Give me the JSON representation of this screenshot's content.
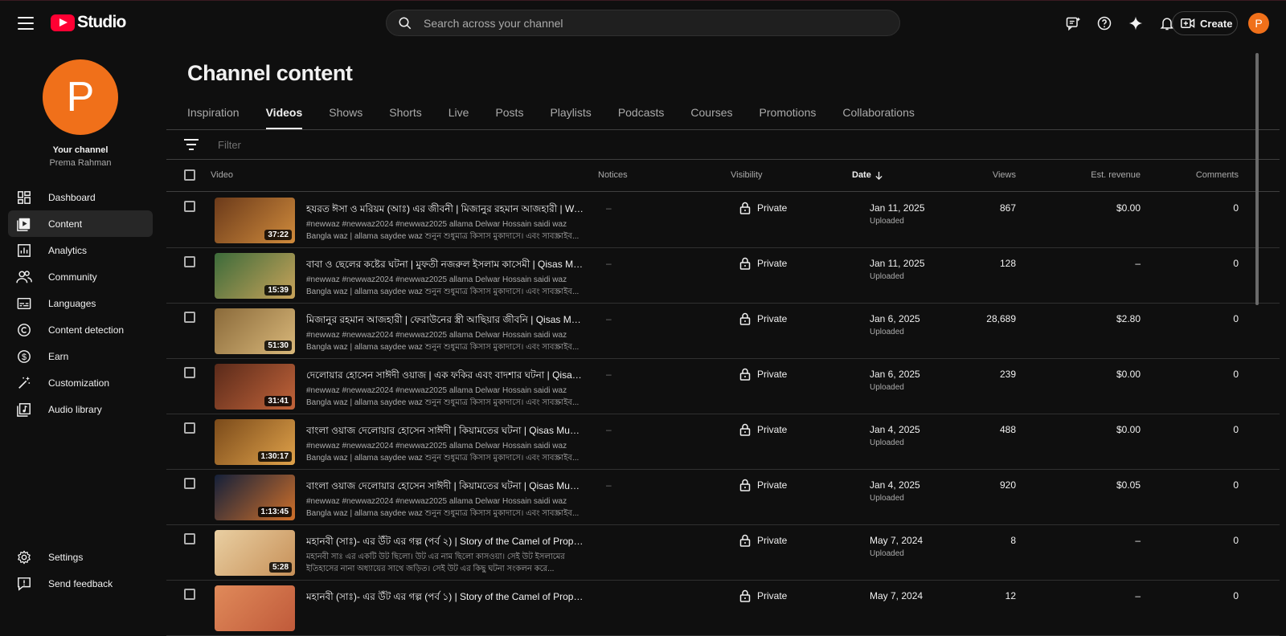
{
  "app": {
    "studio_label": "Studio"
  },
  "search": {
    "placeholder": "Search across your channel"
  },
  "header": {
    "create_label": "Create",
    "avatar_letter": "P"
  },
  "channel": {
    "avatar_letter": "P",
    "your_channel": "Your channel",
    "name": "Prema Rahman"
  },
  "sidebar": {
    "items": [
      {
        "label": "Dashboard",
        "icon": "dashboard-icon"
      },
      {
        "label": "Content",
        "icon": "content-icon",
        "active": true
      },
      {
        "label": "Analytics",
        "icon": "analytics-icon"
      },
      {
        "label": "Community",
        "icon": "community-icon"
      },
      {
        "label": "Languages",
        "icon": "languages-icon"
      },
      {
        "label": "Content detection",
        "icon": "copyright-icon"
      },
      {
        "label": "Earn",
        "icon": "dollar-icon"
      },
      {
        "label": "Customization",
        "icon": "magic-wand-icon"
      },
      {
        "label": "Audio library",
        "icon": "audio-library-icon"
      }
    ],
    "bottom": [
      {
        "label": "Settings",
        "icon": "gear-icon"
      },
      {
        "label": "Send feedback",
        "icon": "feedback-icon"
      }
    ]
  },
  "page": {
    "title": "Channel content",
    "tabs": [
      "Inspiration",
      "Videos",
      "Shows",
      "Shorts",
      "Live",
      "Posts",
      "Playlists",
      "Podcasts",
      "Courses",
      "Promotions",
      "Collaborations"
    ],
    "active_tab": "Videos",
    "filter_placeholder": "Filter"
  },
  "table": {
    "headers": {
      "video": "Video",
      "notices": "Notices",
      "visibility": "Visibility",
      "date": "Date",
      "views": "Views",
      "revenue": "Est. revenue",
      "comments": "Comments"
    },
    "rows": [
      {
        "title": "হযরত ঈসা ও মরিয়ম (আঃ) এর জীবনী | মিজানুর রহমান আজহারী | Wa...",
        "desc1": "#newwaz #newwaz2024 #newwaz2025 allama Delwar Hossain saidi waz",
        "desc2": "Bangla waz | allama saydee waz শুনুন শুধুমাত্র কিসাস মুকাদাসে। এবং সাবস্ক্রাইব...",
        "duration": "37:22",
        "notice": "–",
        "visibility": "Private",
        "date": "Jan 11, 2025",
        "date_sub": "Uploaded",
        "views": "867",
        "revenue": "$0.00",
        "comments": "0",
        "thumb": [
          "#6b3a1a",
          "#d08b3c"
        ]
      },
      {
        "title": "বাবা ও ছেলের কষ্টের ঘটনা | মুফতী নজরুল ইসলাম কাসেমী | Qisas Mu...",
        "desc1": "#newwaz #newwaz2024 #newwaz2025 allama Delwar Hossain saidi waz",
        "desc2": "Bangla waz | allama saydee waz শুনুন শুধুমাত্র কিসাস মুকাদাসে। এবং সাবস্ক্রাইব...",
        "duration": "15:39",
        "notice": "–",
        "visibility": "Private",
        "date": "Jan 11, 2025",
        "date_sub": "Uploaded",
        "views": "128",
        "revenue": "–",
        "comments": "0",
        "thumb": [
          "#3c6b3a",
          "#c9a35a"
        ]
      },
      {
        "title": "মিজানুর রহমান আজহারী | ফেরাউনের স্ত্রী আছিয়ার জীবনি | Qisas Mu...",
        "desc1": "#newwaz #newwaz2024 #newwaz2025 allama Delwar Hossain saidi waz",
        "desc2": "Bangla waz | allama saydee waz শুনুন শুধুমাত্র কিসাস মুকাদাসে। এবং সাবস্ক্রাইব...",
        "duration": "51:30",
        "notice": "–",
        "visibility": "Private",
        "date": "Jan 6, 2025",
        "date_sub": "Uploaded",
        "views": "28,689",
        "revenue": "$2.80",
        "comments": "0",
        "thumb": [
          "#8a6a3a",
          "#d9b87a"
        ]
      },
      {
        "title": "দেলোয়ার হোসেন সাঈদী ওয়াজ | এক ফকির এবং বাদশার ঘটনা | Qisas ...",
        "desc1": "#newwaz #newwaz2024 #newwaz2025 allama Delwar Hossain saidi waz",
        "desc2": "Bangla waz | allama saydee waz শুনুন শুধুমাত্র কিসাস মুকাদাসে। এবং সাবস্ক্রাইব...",
        "duration": "31:41",
        "notice": "–",
        "visibility": "Private",
        "date": "Jan 6, 2025",
        "date_sub": "Uploaded",
        "views": "239",
        "revenue": "$0.00",
        "comments": "0",
        "thumb": [
          "#5a2a1a",
          "#c2643a"
        ]
      },
      {
        "title": "বাংলা ওয়াজ দেলোয়ার হোসেন সাঈদী | কিয়ামতের ঘটনা | Qisas Muqa...",
        "desc1": "#newwaz #newwaz2024 #newwaz2025 allama Delwar Hossain saidi waz",
        "desc2": "Bangla waz | allama saydee waz শুনুন শুধুমাত্র কিসাস মুকাদাসে। এবং সাবস্ক্রাইব...",
        "duration": "1:30:17",
        "notice": "–",
        "visibility": "Private",
        "date": "Jan 4, 2025",
        "date_sub": "Uploaded",
        "views": "488",
        "revenue": "$0.00",
        "comments": "0",
        "thumb": [
          "#7a4a1a",
          "#e0a24a"
        ]
      },
      {
        "title": "বাংলা ওয়াজ দেলোয়ার হোসেন সাঈদী | কিয়ামতের ঘটনা | Qisas Muqa...",
        "desc1": "#newwaz #newwaz2024 #newwaz2025 allama Delwar Hossain saidi waz",
        "desc2": "Bangla waz | allama saydee waz শুনুন শুধুমাত্র কিসাস মুকাদাসে। এবং সাবস্ক্রাইব...",
        "duration": "1:13:45",
        "notice": "–",
        "visibility": "Private",
        "date": "Jan 4, 2025",
        "date_sub": "Uploaded",
        "views": "920",
        "revenue": "$0.05",
        "comments": "0",
        "thumb": [
          "#14203a",
          "#d0702a"
        ]
      },
      {
        "title": "মহানবী (সাঃ)- এর উঁট এর গল্প (পর্ব ২) | Story of the Camel of Prophet ...",
        "desc1": "মহানবী সাঃ এর একটি উট ছিলো। উট এর নাম ছিলো কাসওয়া। সেই উট ইসলামের",
        "desc2": "ইতিহাসের নানা অধ্যায়ের সাথে জড়িত। সেই উট এর কিছু ঘটনা সংকলন করে...",
        "duration": "5:28",
        "notice": "",
        "visibility": "Private",
        "date": "May 7, 2024",
        "date_sub": "Uploaded",
        "views": "8",
        "revenue": "–",
        "comments": "0",
        "thumb": [
          "#e9cfa2",
          "#c79058"
        ]
      },
      {
        "title": "মহানবী (সাঃ)- এর উঁট এর গল্প (পর্ব ১) | Story of the Camel of Prophet ...",
        "desc1": "",
        "desc2": "",
        "duration": "",
        "notice": "",
        "visibility": "Private",
        "date": "May 7, 2024",
        "date_sub": "",
        "views": "12",
        "revenue": "–",
        "comments": "0",
        "thumb": [
          "#e08a5a",
          "#c05a3a"
        ]
      }
    ]
  },
  "colors": {
    "accent_red": "#ff0033",
    "avatar_orange": "#f0701a",
    "bg": "#0f0f0f"
  }
}
